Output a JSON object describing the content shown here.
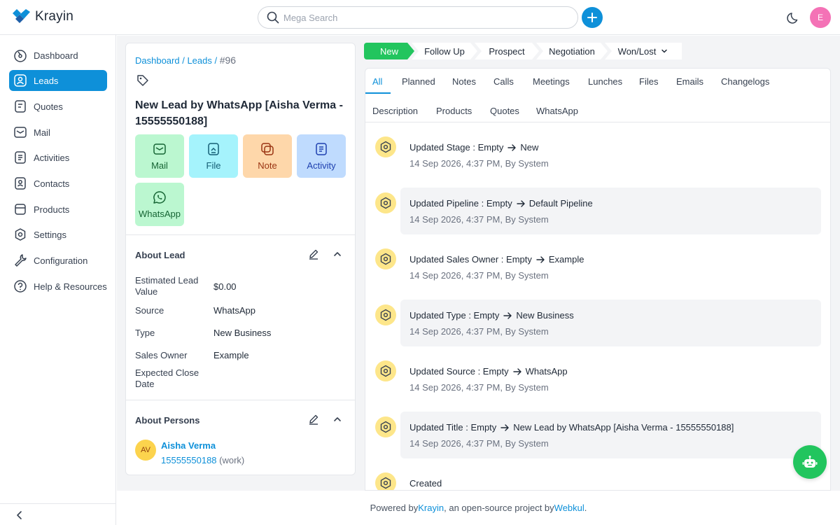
{
  "app": {
    "name": "Krayin"
  },
  "header": {
    "search_placeholder": "Mega Search",
    "user_initial": "E"
  },
  "sidebar": {
    "items": [
      {
        "label": "Dashboard",
        "icon": "dashboard-icon"
      },
      {
        "label": "Leads",
        "icon": "leads-icon",
        "active": true
      },
      {
        "label": "Quotes",
        "icon": "quotes-icon"
      },
      {
        "label": "Mail",
        "icon": "mail-icon"
      },
      {
        "label": "Activities",
        "icon": "activities-icon"
      },
      {
        "label": "Contacts",
        "icon": "contacts-icon"
      },
      {
        "label": "Products",
        "icon": "products-icon"
      },
      {
        "label": "Settings",
        "icon": "settings-icon"
      },
      {
        "label": "Configuration",
        "icon": "configuration-icon"
      },
      {
        "label": "Help & Resources",
        "icon": "help-icon"
      }
    ]
  },
  "breadcrumb": {
    "dashboard": "Dashboard",
    "sep1": " / ",
    "leads": "Leads",
    "sep2": " / ",
    "current": "#96"
  },
  "lead": {
    "title": "New Lead by WhatsApp [Aisha Verma - 15555550188]",
    "actions": {
      "mail": "Mail",
      "file": "File",
      "note": "Note",
      "activity": "Activity",
      "whatsapp": "WhatsApp"
    }
  },
  "about_lead": {
    "title": "About Lead",
    "fields": [
      {
        "label": "Estimated Lead Value",
        "value": "$0.00"
      },
      {
        "label": "Source",
        "value": "WhatsApp"
      },
      {
        "label": "Type",
        "value": "New Business"
      },
      {
        "label": "Sales Owner",
        "value": "Example"
      },
      {
        "label": "Expected Close Date",
        "value": ""
      }
    ]
  },
  "about_persons": {
    "title": "About Persons",
    "person": {
      "initials": "AV",
      "name": "Aisha Verma",
      "phone": "15555550188",
      "phone_type": "(work)"
    }
  },
  "stages": [
    "New",
    "Follow Up",
    "Prospect",
    "Negotiation",
    "Won/Lost"
  ],
  "tabs_row1": [
    "All",
    "Planned",
    "Notes",
    "Calls",
    "Meetings",
    "Lunches",
    "Files",
    "Emails",
    "Changelogs"
  ],
  "tabs_row2": [
    "Description",
    "Products",
    "Quotes",
    "WhatsApp"
  ],
  "activities": [
    {
      "title": "Updated Stage : Empty",
      "to": "New",
      "meta": "14 Sep 2026, 4:37 PM, By System"
    },
    {
      "title": "Updated Pipeline : Empty",
      "to": "Default Pipeline",
      "meta": "14 Sep 2026, 4:37 PM, By System"
    },
    {
      "title": "Updated Sales Owner : Empty",
      "to": "Example",
      "meta": "14 Sep 2026, 4:37 PM, By System"
    },
    {
      "title": "Updated Type : Empty",
      "to": "New Business",
      "meta": "14 Sep 2026, 4:37 PM, By System"
    },
    {
      "title": "Updated Source : Empty",
      "to": "WhatsApp",
      "meta": "14 Sep 2026, 4:37 PM, By System"
    },
    {
      "title": "Updated Title : Empty",
      "to": "New Lead by WhatsApp [Aisha Verma - 15555550188]",
      "meta": "14 Sep 2026, 4:37 PM, By System"
    },
    {
      "title": "Created",
      "to": "",
      "meta": ""
    }
  ],
  "footer": {
    "prefix": "Powered by ",
    "krayin": "Krayin",
    "middle": ", an open-source project by ",
    "webkul": "Webkul",
    "suffix": "."
  },
  "colors": {
    "accent": "#0e90d9",
    "stage_active": "#22c55e",
    "activity_icon_bg": "#fde68a"
  }
}
